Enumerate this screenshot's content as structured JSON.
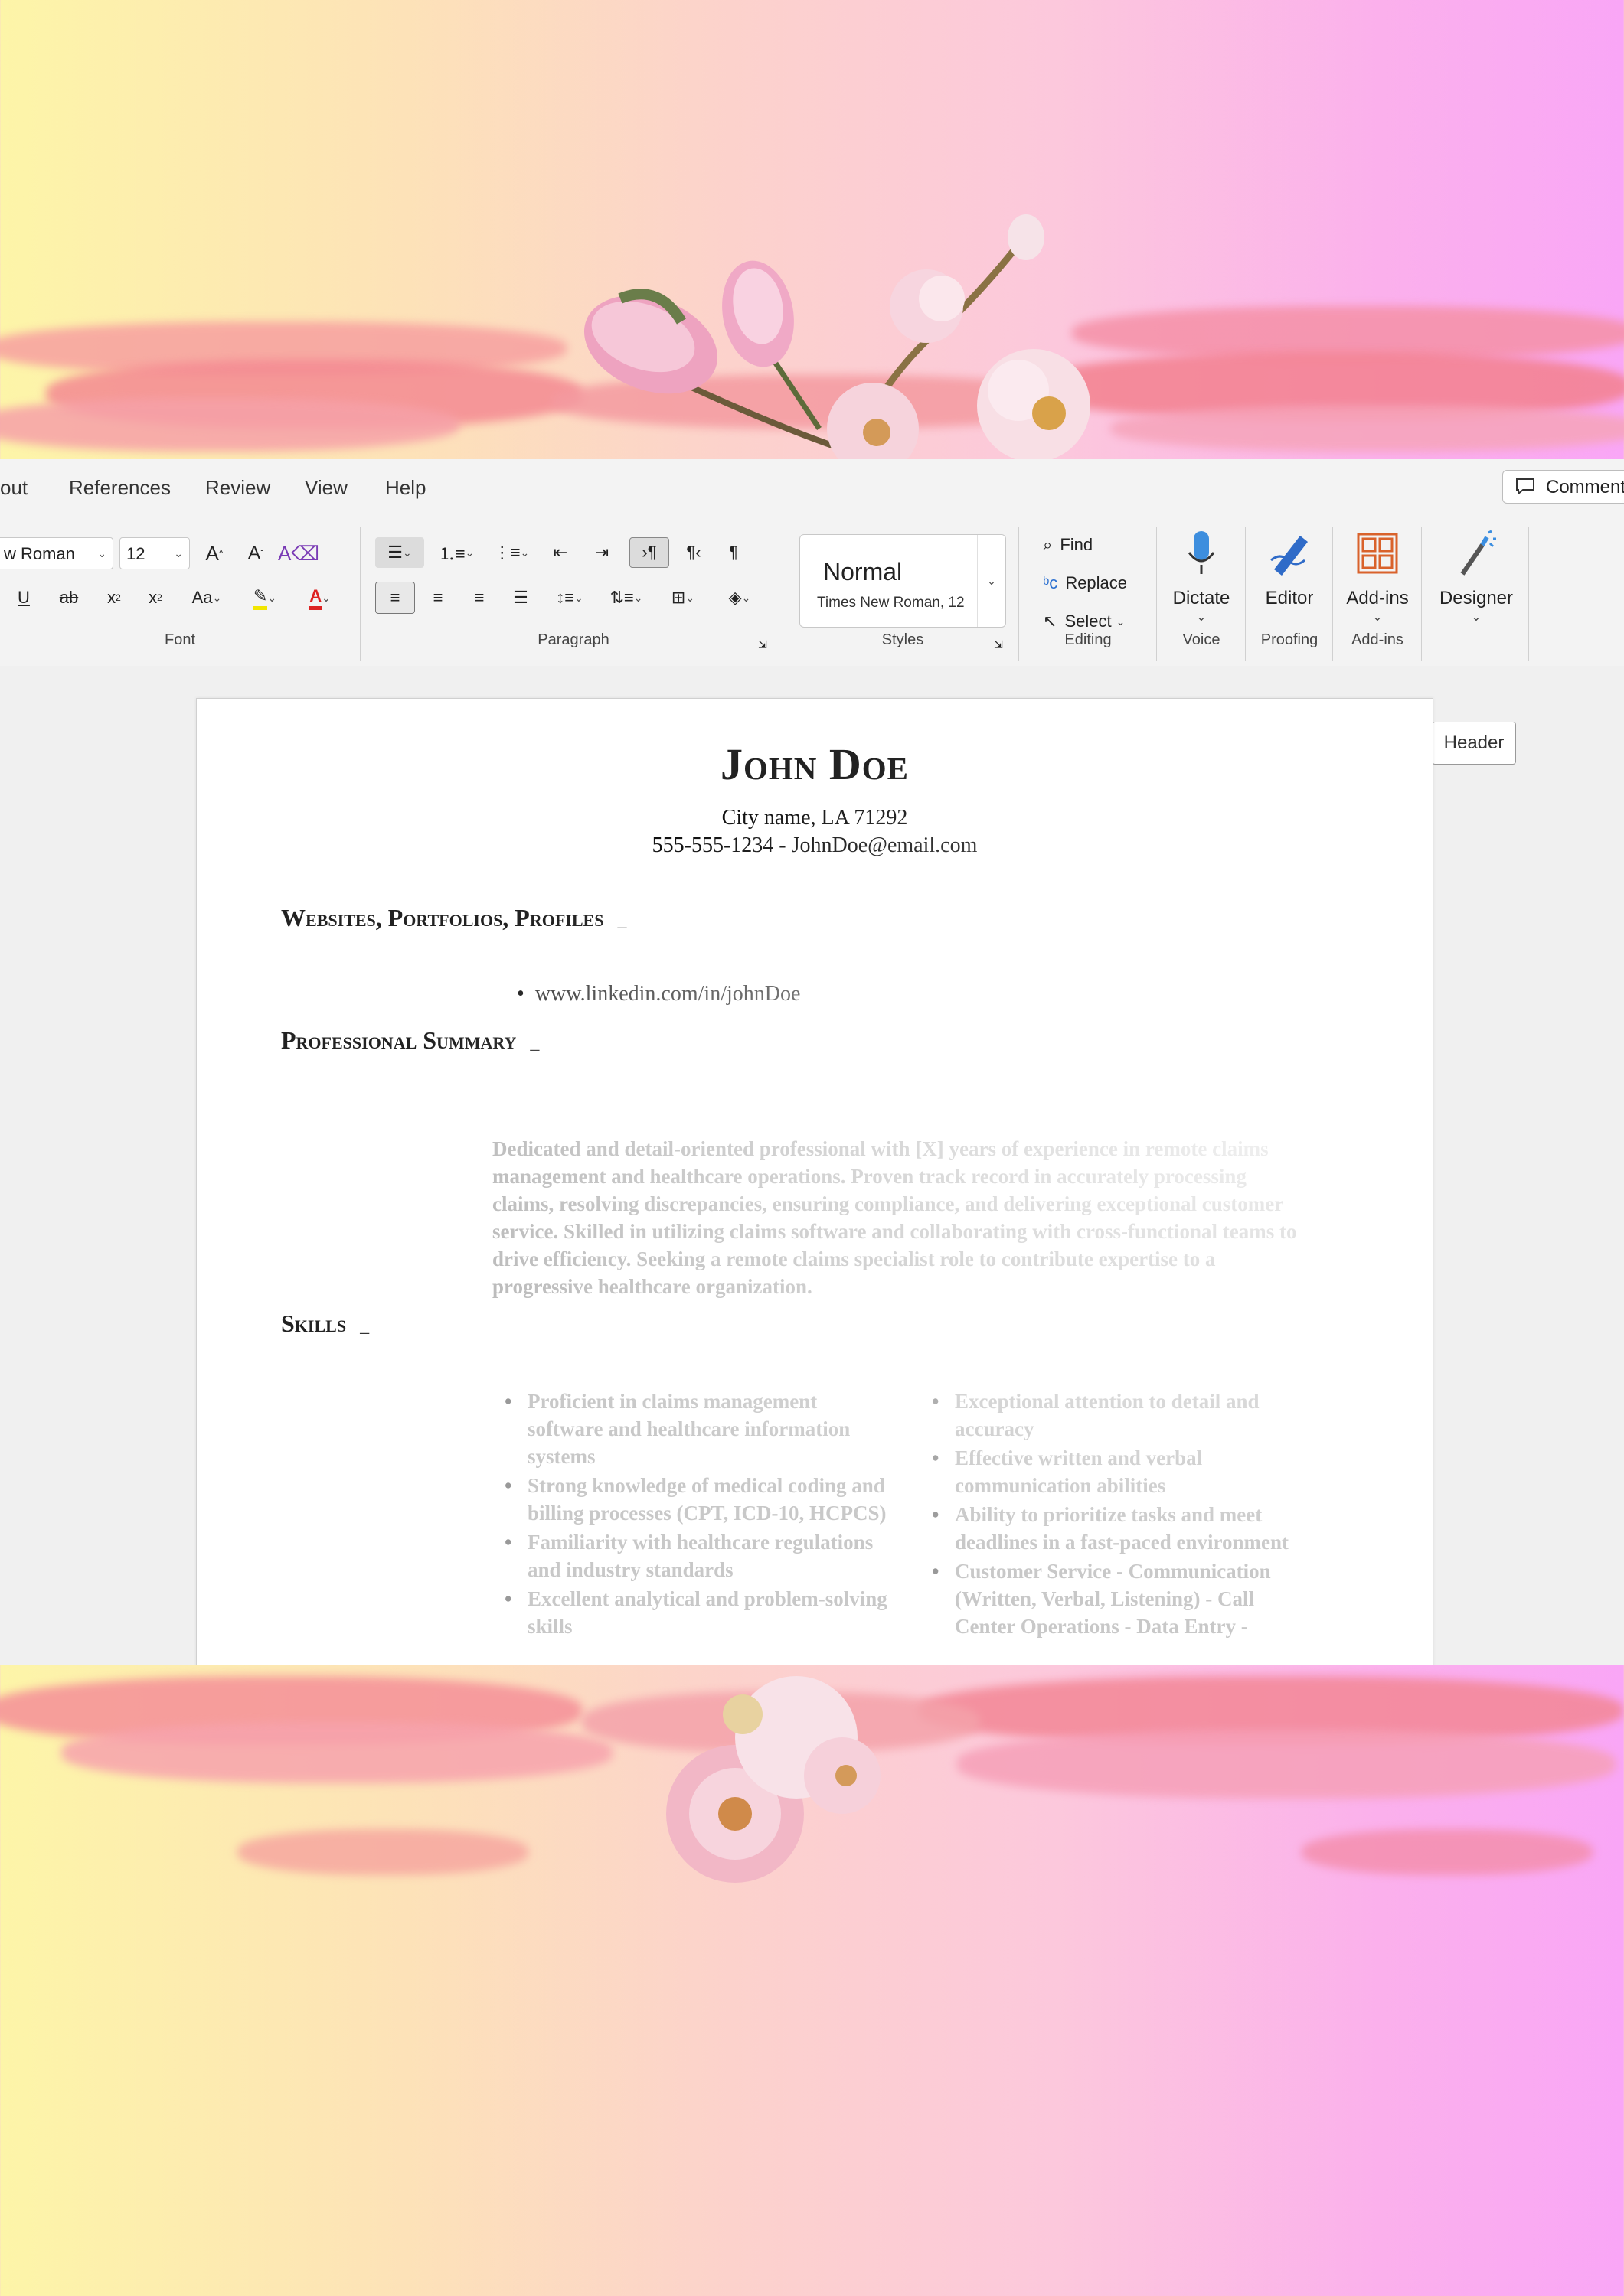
{
  "ribbon": {
    "tabs": [
      "out",
      "References",
      "Review",
      "View",
      "Help"
    ],
    "comment_label": "Comment",
    "font": {
      "font_name": "w Roman",
      "font_size": "12",
      "group_label": "Font"
    },
    "paragraph": {
      "group_label": "Paragraph"
    },
    "styles": {
      "style_name": "Normal",
      "style_desc": "Times New Roman, 12",
      "group_label": "Styles"
    },
    "editing": {
      "find": "Find",
      "replace": "Replace",
      "select": "Select",
      "group_label": "Editing"
    },
    "voice": {
      "dictate": "Dictate",
      "group_label": "Voice"
    },
    "proofing": {
      "editor": "Editor",
      "group_label": "Proofing"
    },
    "addins": {
      "addins": "Add-ins",
      "group_label": "Add-ins"
    },
    "designer": {
      "designer": "Designer"
    }
  },
  "document": {
    "header_tag": "Header",
    "name": "John Doe",
    "city": "City name, LA 71292",
    "contact_line": "555-555-1234 - JohnDoe@email.com",
    "sections": {
      "websites": "Websites, Portfolios, Profiles",
      "summary_title": "Professional Summary",
      "skills_title": "Skills"
    },
    "linkedin": "www.linkedin.com/in/johnDoe",
    "summary": "Dedicated and detail-oriented professional with [X] years of experience in remote claims management and healthcare operations. Proven track record in accurately processing claims, resolving discrepancies, ensuring compliance, and delivering exceptional customer service. Skilled in utilizing claims software and collaborating with cross-functional teams to drive efficiency. Seeking a remote claims specialist role to contribute expertise to a progressive healthcare organization.",
    "skills_left": [
      "Proficient in claims management software and healthcare information systems",
      "Strong knowledge of medical coding and billing processes (CPT, ICD-10, HCPCS)",
      "Familiarity with healthcare regulations and industry standards",
      "Excellent analytical and problem-solving skills"
    ],
    "skills_right": [
      "Exceptional attention to detail and accuracy",
      "Effective written and verbal communication abilities",
      "Ability to prioritize tasks and meet deadlines in a fast-paced environment",
      "Customer Service - Communication (Written, Verbal, Listening) - Call Center Operations - Data Entry -"
    ]
  }
}
